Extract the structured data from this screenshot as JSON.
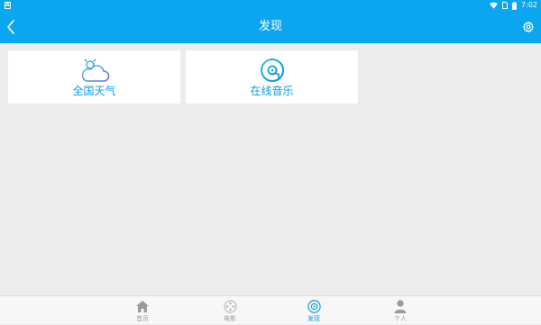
{
  "status_bar": {
    "left_icon": "notification-a-icon",
    "time": "7:02",
    "icons": [
      "wifi-icon",
      "sim-card-icon",
      "battery-icon"
    ]
  },
  "header": {
    "title": "发现",
    "back_icon": "chevron-left-icon",
    "settings_icon": "gear-icon"
  },
  "cards": [
    {
      "label": "全国天气",
      "icon": "weather-cloud-sun-icon"
    },
    {
      "label": "在线音乐",
      "icon": "music-disc-icon"
    }
  ],
  "bottom_nav": {
    "items": [
      {
        "label": "首页",
        "icon": "home-icon",
        "active": false
      },
      {
        "label": "电影",
        "icon": "film-reel-icon",
        "active": false
      },
      {
        "label": "发现",
        "icon": "compass-icon",
        "active": true
      },
      {
        "label": "个人",
        "icon": "person-icon",
        "active": false
      }
    ]
  },
  "colors": {
    "accent": "#0aa6ef",
    "card_text": "#0a9be6",
    "background": "#ececec",
    "nav_inactive": "#999999"
  }
}
